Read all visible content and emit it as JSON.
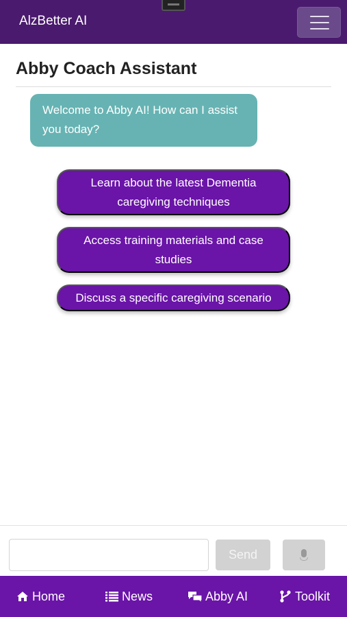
{
  "header": {
    "brand": "AlzBetter AI",
    "menu_icon": "hamburger-icon"
  },
  "page": {
    "title": "Abby Coach Assistant"
  },
  "chat": {
    "welcome": "Welcome to Abby AI! How can I assist you today?",
    "suggestions": [
      "Learn about the latest Dementia caregiving techniques",
      "Access training materials and case studies",
      "Discuss a specific caregiving scenario"
    ]
  },
  "composer": {
    "input_value": "",
    "placeholder": "",
    "send_label": "Send",
    "mic_icon": "microphone-icon"
  },
  "nav": {
    "items": [
      {
        "label": "Home",
        "icon": "home-icon"
      },
      {
        "label": "News",
        "icon": "list-icon"
      },
      {
        "label": "Abby AI",
        "icon": "chat-icon"
      },
      {
        "label": "Toolkit",
        "icon": "branch-icon"
      }
    ]
  },
  "colors": {
    "header_bg": "#4a1a6e",
    "accent_purple": "#6a14a8",
    "bot_bubble": "#67b3b3",
    "disabled_button": "#d2d2d2"
  }
}
